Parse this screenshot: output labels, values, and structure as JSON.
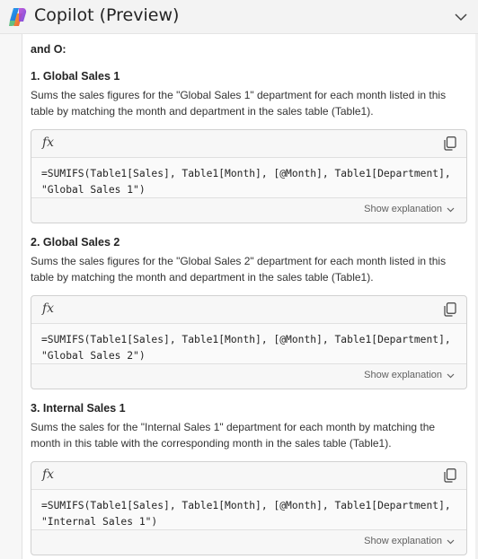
{
  "header": {
    "title": "Copilot (Preview)"
  },
  "intro_text": "and O:",
  "sections": [
    {
      "heading": "1. Global Sales 1",
      "description": "Sums the sales figures for the \"Global Sales 1\" department for each month listed in this table by matching the month and department in the sales table (Table1).",
      "formula_line1": "=SUMIFS(Table1[Sales], Table1[Month], [@Month], Table1[Department],",
      "formula_line2": "\"Global Sales 1\")",
      "explain_label": "Show explanation"
    },
    {
      "heading": "2. Global Sales 2",
      "description": "Sums the sales figures for the \"Global Sales 2\" department for each month listed in this table by matching the month and department in the sales table (Table1).",
      "formula_line1": "=SUMIFS(Table1[Sales], Table1[Month], [@Month], Table1[Department],",
      "formula_line2": "\"Global Sales 2\")",
      "explain_label": "Show explanation"
    },
    {
      "heading": "3. Internal Sales 1",
      "description": "Sums the sales for the \"Internal Sales 1\" department for each month by matching the month in this table with the corresponding month in the sales table (Table1).",
      "formula_line1": "=SUMIFS(Table1[Sales], Table1[Month], [@Month], Table1[Department],",
      "formula_line2": "\"Internal Sales 1\")",
      "explain_label": "Show explanation"
    }
  ],
  "icons": {
    "logo": "copilot-logo-icon",
    "collapse": "chevron-down-icon",
    "formula": "fx-icon",
    "copy": "copy-icon",
    "explain": "chevron-down-icon"
  }
}
